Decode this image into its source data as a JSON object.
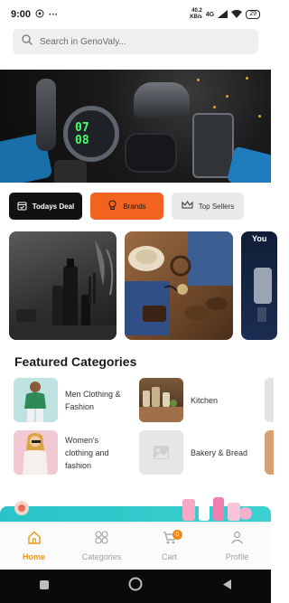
{
  "status_bar": {
    "time": "9:00",
    "net_speed_value": "40.2",
    "net_speed_unit": "KB/s",
    "network": "4G",
    "battery": "29"
  },
  "search": {
    "placeholder": "Search in GenoValy..."
  },
  "banner": {
    "watch_display": "07\n08"
  },
  "chips": [
    {
      "label": "Todays Deal",
      "icon": "calendar-icon"
    },
    {
      "label": "Brands",
      "icon": "lightbulb-icon"
    },
    {
      "label": "Top Sellers",
      "icon": "crown-icon"
    }
  ],
  "promos": {
    "third_card_text": "You"
  },
  "featured": {
    "title": "Featured Categories",
    "items": [
      {
        "label": "Men Clothing &\nFashion"
      },
      {
        "label": "Kitchen"
      },
      {
        "label": "Women's\nclothing and\nfashion"
      },
      {
        "label": "Bakery & Bread"
      }
    ]
  },
  "bottom_nav": {
    "items": [
      {
        "label": "Home",
        "icon": "home-icon",
        "active": true
      },
      {
        "label": "Categories",
        "icon": "grid-icon",
        "active": false
      },
      {
        "label": "Cart",
        "icon": "cart-icon",
        "active": false,
        "badge": "0"
      },
      {
        "label": "Profile",
        "icon": "user-icon",
        "active": false
      }
    ]
  },
  "colors": {
    "accent_orange": "#f4621f",
    "active_nav": "#e59a1c",
    "dark_chip": "#111111"
  }
}
